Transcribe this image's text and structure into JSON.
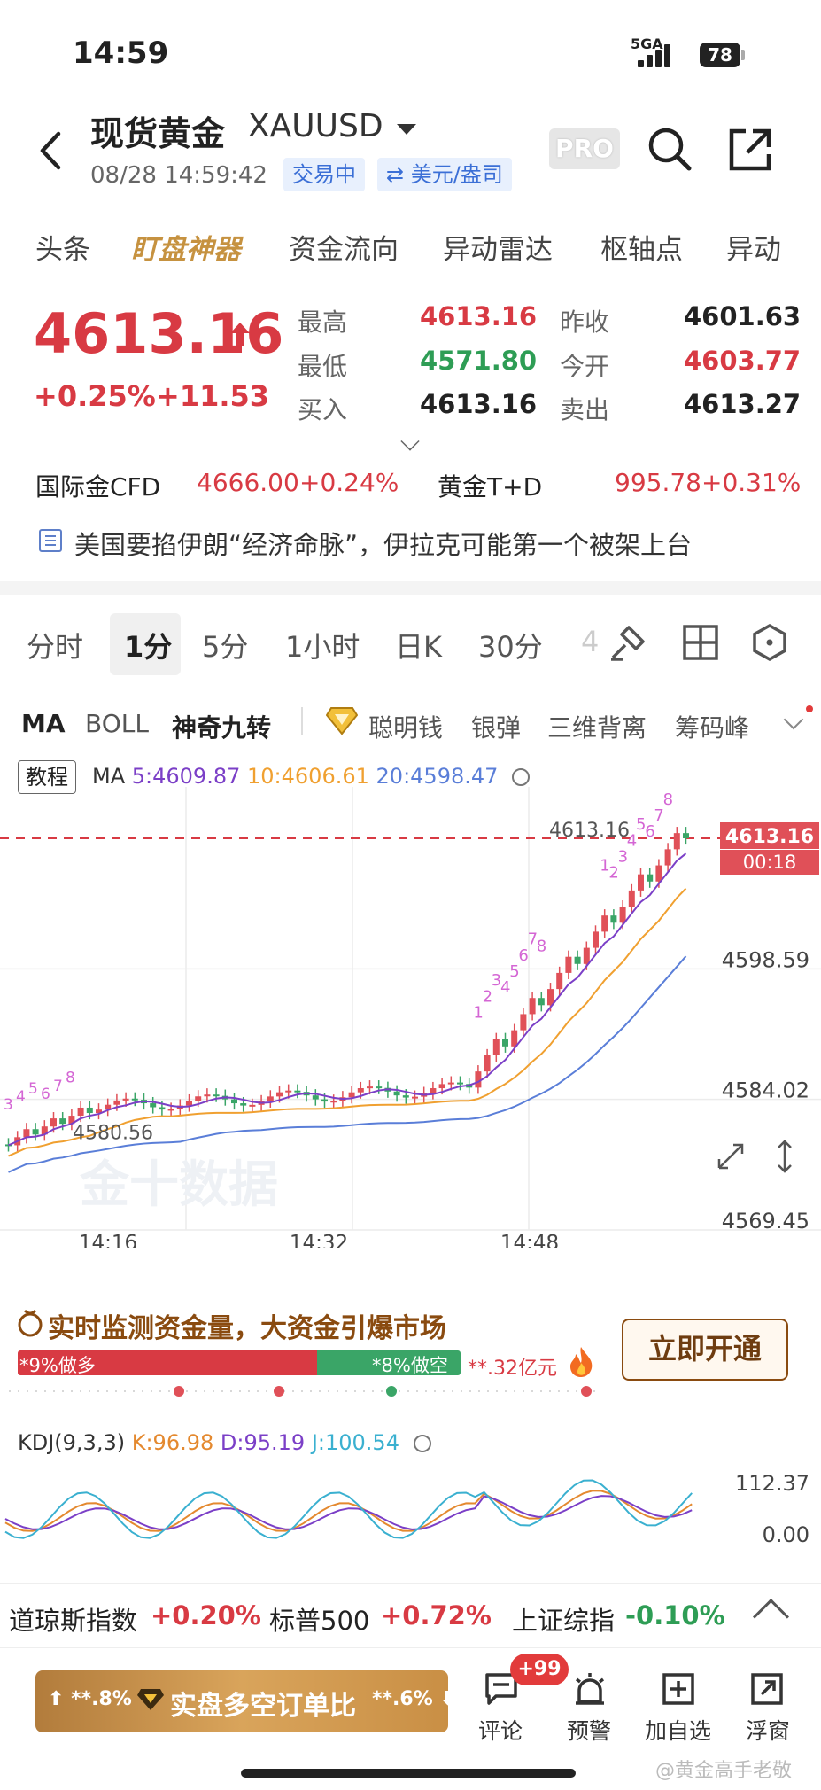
{
  "status_bar": {
    "time": "14:59",
    "network": "5GA",
    "battery": "78"
  },
  "header": {
    "title": "现货黄金",
    "symbol": "XAUUSD",
    "datetime": "08/28 14:59:42",
    "trading_status": "交易中",
    "unit": "⇄ 美元/盎司",
    "pro": "PRO"
  },
  "tabs": [
    "头条",
    "盯盘神器",
    "资金流向",
    "异动雷达",
    "枢轴点",
    "异动"
  ],
  "quote": {
    "price": "4613.16",
    "change_pct": "+0.25%",
    "change_abs": "+11.53",
    "high_label": "最高",
    "high": "4613.16",
    "low_label": "最低",
    "low": "4571.80",
    "bid_label": "买入",
    "bid": "4613.16",
    "prev_close_label": "昨收",
    "prev_close": "4601.63",
    "open_label": "今开",
    "open": "4603.77",
    "ask_label": "卖出",
    "ask": "4613.27"
  },
  "refs": [
    {
      "name": "国际金CFD",
      "price": "4666.00",
      "pct": "+0.24%"
    },
    {
      "name": "黄金T+D",
      "price": "995.78",
      "pct": "+0.31%"
    }
  ],
  "news": "美国要掐伊朗“经济命脉”，伊拉克可能第一个被架上台",
  "period_tabs": [
    "分时",
    "1分",
    "5分",
    "1小时",
    "日K",
    "30分",
    "4"
  ],
  "indicator_tabs": {
    "ma": "MA",
    "boll": "BOLL",
    "magic": "神奇九转",
    "smart": "聪明钱",
    "silver": "银弹",
    "three": "三维背离",
    "chip": "筹码峰"
  },
  "chart": {
    "tutorial": "教程",
    "ma_title": "MA",
    "ma5": "5:4609.87",
    "ma10": "10:4606.61",
    "ma20": "20:4598.47",
    "y_labels": [
      "4613.16",
      "4598.59",
      "4584.02",
      "4569.45"
    ],
    "x_labels": [
      "14:16",
      "14:32",
      "14:48"
    ],
    "price_tag": "4613.16",
    "countdown": "00:18",
    "high_marker": "4613.16",
    "low_marker": "4580.56",
    "watermark": "金十数据",
    "colors": {
      "up": "#e05058",
      "down": "#3aa567",
      "ma5": "#7b3fc7",
      "ma10": "#f0a030",
      "ma20": "#5a7ed8"
    }
  },
  "capital": {
    "title": "实时监测资金量，大资金引爆市场",
    "long": "*9%做多",
    "short": "*8%做空",
    "amount": "**.32亿元",
    "button": "立即开通"
  },
  "kdj": {
    "label": "KDJ(9,3,3)",
    "k": "K:96.98",
    "d": "D:95.19",
    "j": "J:100.54",
    "y_top": "112.37",
    "y_bottom": "0.00"
  },
  "indices": [
    {
      "name": "道琼斯指数",
      "pct": "+0.20%"
    },
    {
      "name": "标普500",
      "pct": "+0.72%"
    },
    {
      "name": "上证综指",
      "pct": "-0.10%"
    }
  ],
  "bottom": {
    "promo_left": "⬆ **.8%",
    "promo_mid": "实盘多空订单比",
    "promo_right": "**.6% ⬇",
    "badge": "+99",
    "comment": "评论",
    "alert": "预警",
    "watchlist": "加自选",
    "float": "浮窗",
    "watermark": "@黄金高手老敬"
  }
}
